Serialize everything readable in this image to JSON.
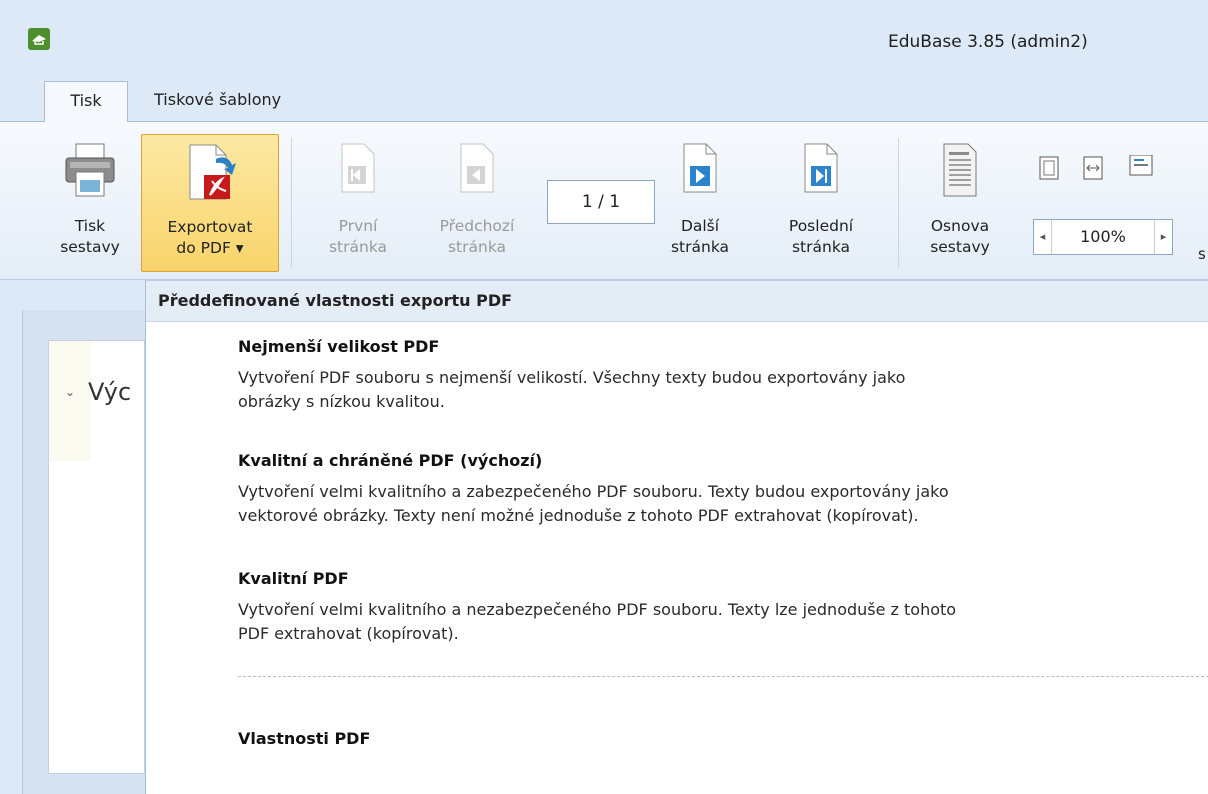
{
  "window": {
    "title": "EduBase 3.85 (admin2)"
  },
  "tabs": [
    {
      "label": "Tisk",
      "active": true
    },
    {
      "label": "Tiskové šablony",
      "active": false
    }
  ],
  "ribbon": {
    "print_report": {
      "line1": "Tisk",
      "line2": "sestavy",
      "icon": "printer-icon"
    },
    "export_pdf": {
      "line1": "Exportovat",
      "line2": "do PDF ▾",
      "icon": "pdf-export-icon"
    },
    "first_page": {
      "line1": "První",
      "line2": "stránka",
      "icon": "first-page-icon"
    },
    "prev_page": {
      "line1": "Předchozí",
      "line2": "stránka",
      "icon": "previous-page-icon"
    },
    "page_indicator": "1 / 1",
    "next_page": {
      "line1": "Další",
      "line2": "stránka",
      "icon": "next-page-icon"
    },
    "last_page": {
      "line1": "Poslední",
      "line2": "stránka",
      "icon": "last-page-icon"
    },
    "outline": {
      "line1": "Osnova",
      "line2": "sestavy",
      "icon": "outline-icon"
    },
    "zoom": {
      "value": "100%",
      "left": "◂",
      "right": "▸"
    },
    "cut_label": "s"
  },
  "left_pane": {
    "section_label": "Výc",
    "chevron": "⌄"
  },
  "dropdown": {
    "header": "Předdefinované vlastnosti exportu PDF",
    "items": [
      {
        "title": "Nejmenší velikost PDF",
        "line1": "Vytvoření PDF souboru s nejmenší velikostí. Všechny texty budou exportovány jako",
        "line2": "obrázky s nízkou kvalitou."
      },
      {
        "title": "Kvalitní a chráněné PDF (výchozí)",
        "line1": "Vytvoření velmi kvalitního a zabezpečeného PDF souboru. Texty budou exportovány jako",
        "line2": "vektorové obrázky. Texty není možné jednoduše z tohoto PDF extrahovat (kopírovat)."
      },
      {
        "title": "Kvalitní PDF",
        "line1": "Vytvoření velmi kvalitního a nezabezpečeného PDF souboru. Texty lze jednoduše z tohoto",
        "line2": "PDF extrahovat (kopírovat)."
      }
    ],
    "properties": "Vlastnosti PDF"
  }
}
